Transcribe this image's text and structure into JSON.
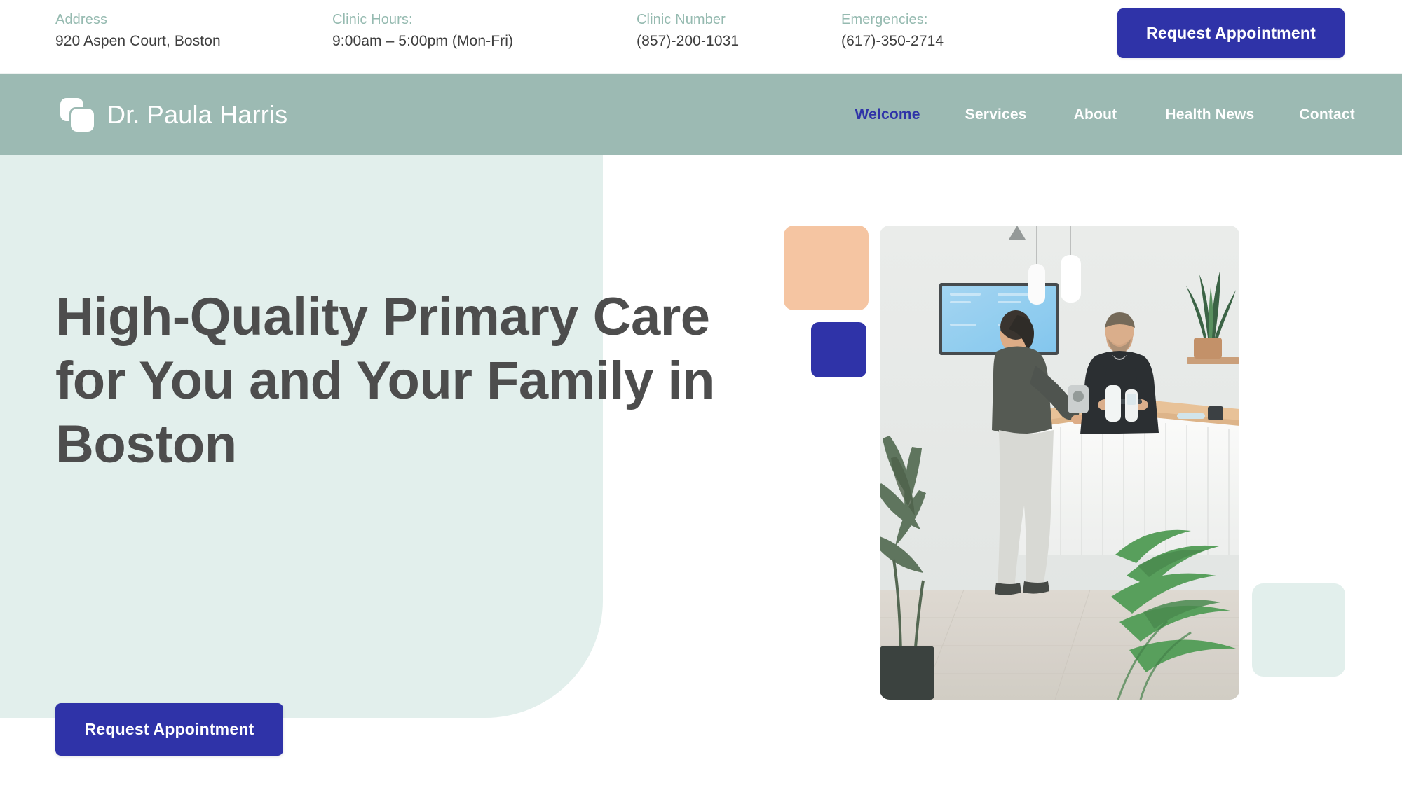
{
  "topbar": {
    "items": [
      {
        "label": "Address",
        "value": "920 Aspen Court, Boston"
      },
      {
        "label": "Clinic Hours:",
        "value": "9:00am – 5:00pm (Mon-Fri)"
      },
      {
        "label": "Clinic Number",
        "value": "(857)-200-1031"
      },
      {
        "label": "Emergencies:",
        "value": "(617)-350-2714"
      }
    ],
    "cta_label": "Request Appointment"
  },
  "nav": {
    "brand": "Dr. Paula Harris",
    "logo_icon": "overlapping-squares-logo-icon",
    "links": [
      {
        "label": "Welcome",
        "active": true
      },
      {
        "label": "Services",
        "active": false
      },
      {
        "label": "About",
        "active": false
      },
      {
        "label": "Health News",
        "active": false
      },
      {
        "label": "Contact",
        "active": false
      }
    ]
  },
  "hero": {
    "title": "High-Quality Primary Care for You and Your Family in Boston",
    "cta_label": "Request Appointment",
    "photo_alt": "clinic-reception-photo"
  },
  "colors": {
    "accent_blue": "#2f33a8",
    "nav_green": "#9cbab3",
    "panel_mint": "#e2efec",
    "deco_peach": "#f5c5a2",
    "heading_gray": "#4d4d4d",
    "label_sage": "#95bab0",
    "value_gray": "#3f3f3f"
  }
}
